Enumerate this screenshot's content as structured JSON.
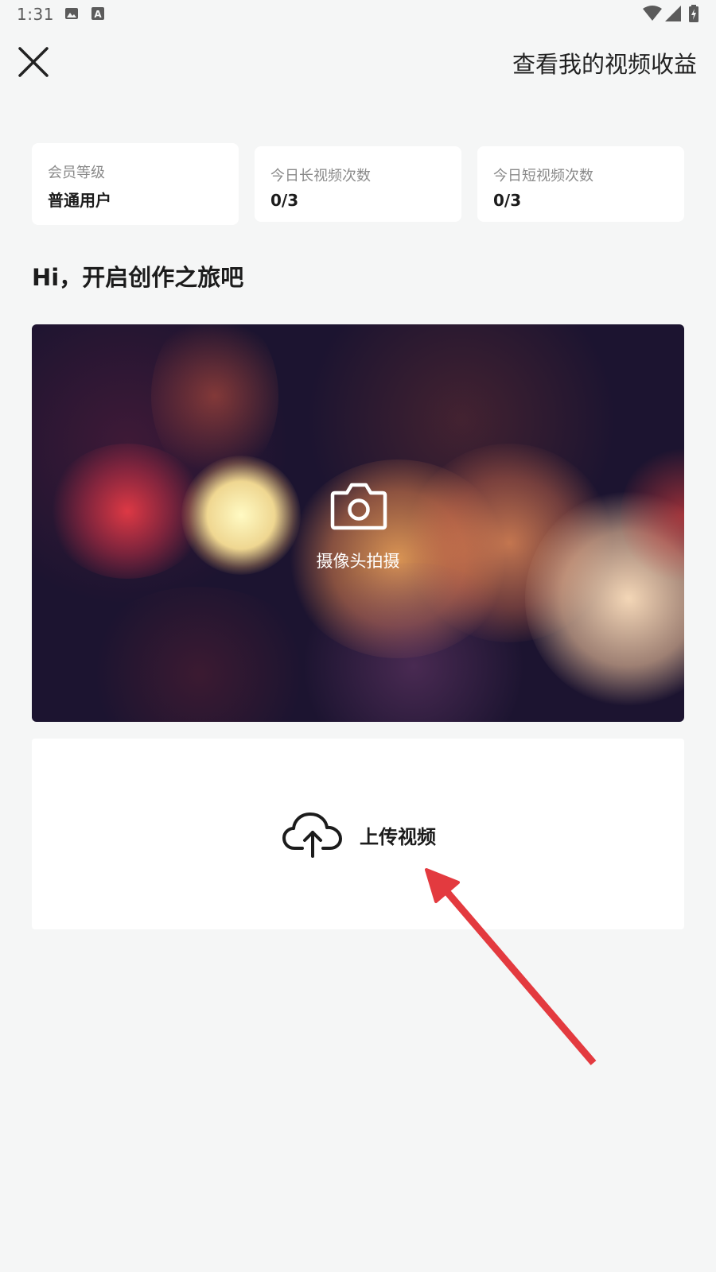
{
  "status_bar": {
    "time": "1:31",
    "icons": [
      "image-icon",
      "text-a-icon",
      "wifi-icon",
      "signal-icon",
      "battery-charging-icon"
    ]
  },
  "header": {
    "close_icon": "close-icon",
    "link_label": "查看我的视频收益"
  },
  "stats": [
    {
      "label": "会员等级",
      "value": "普通用户"
    },
    {
      "label": "今日长视频次数",
      "value": "0/3"
    },
    {
      "label": "今日短视频次数",
      "value": "0/3"
    }
  ],
  "greeting": "Hi，开启创作之旅吧",
  "camera": {
    "icon": "camera-icon",
    "label": "摄像头拍摄"
  },
  "upload": {
    "icon": "cloud-upload-icon",
    "label": "上传视频"
  },
  "colors": {
    "background": "#f5f6f6",
    "card": "#ffffff",
    "annotation_arrow": "#e33a3f"
  }
}
